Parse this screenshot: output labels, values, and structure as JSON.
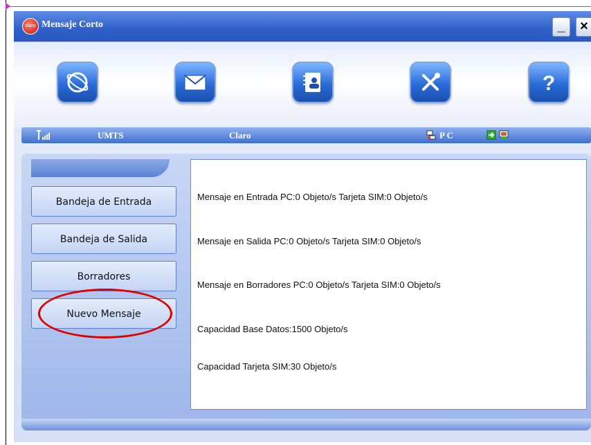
{
  "window": {
    "title": "Mensaje Corto",
    "logo_text": "claro",
    "minimize_label": "_",
    "close_label": "×"
  },
  "toolbar": {
    "icons": [
      "internet-globe-icon",
      "message-envelope-icon",
      "contacts-book-icon",
      "settings-tools-icon",
      "help-question-icon"
    ],
    "help_glyph": "?"
  },
  "status": {
    "network_type": "UMTS",
    "operator": "Claro",
    "storage": "P C"
  },
  "sidebar": {
    "items": [
      {
        "label": "Bandeja de Entrada"
      },
      {
        "label": "Bandeja de Salida"
      },
      {
        "label": "Borradores"
      },
      {
        "label": "Nuevo Mensaje"
      }
    ]
  },
  "panel": {
    "lines": [
      "Mensaje en Entrada PC:0 Objeto/s Tarjeta SIM:0 Objeto/s",
      "Mensaje en Salida PC:0 Objeto/s Tarjeta SIM:0 Objeto/s",
      "Mensaje en Borradores PC:0 Objeto/s Tarjeta SIM:0 Objeto/s",
      "Capacidad Base Datos:1500 Objeto/s",
      "Capacidad Tarjeta SIM:30 Objeto/s"
    ]
  },
  "colors": {
    "titlebar": "#2f60c8",
    "annotation": "#e00000",
    "frame_line": "#cc33cc"
  }
}
